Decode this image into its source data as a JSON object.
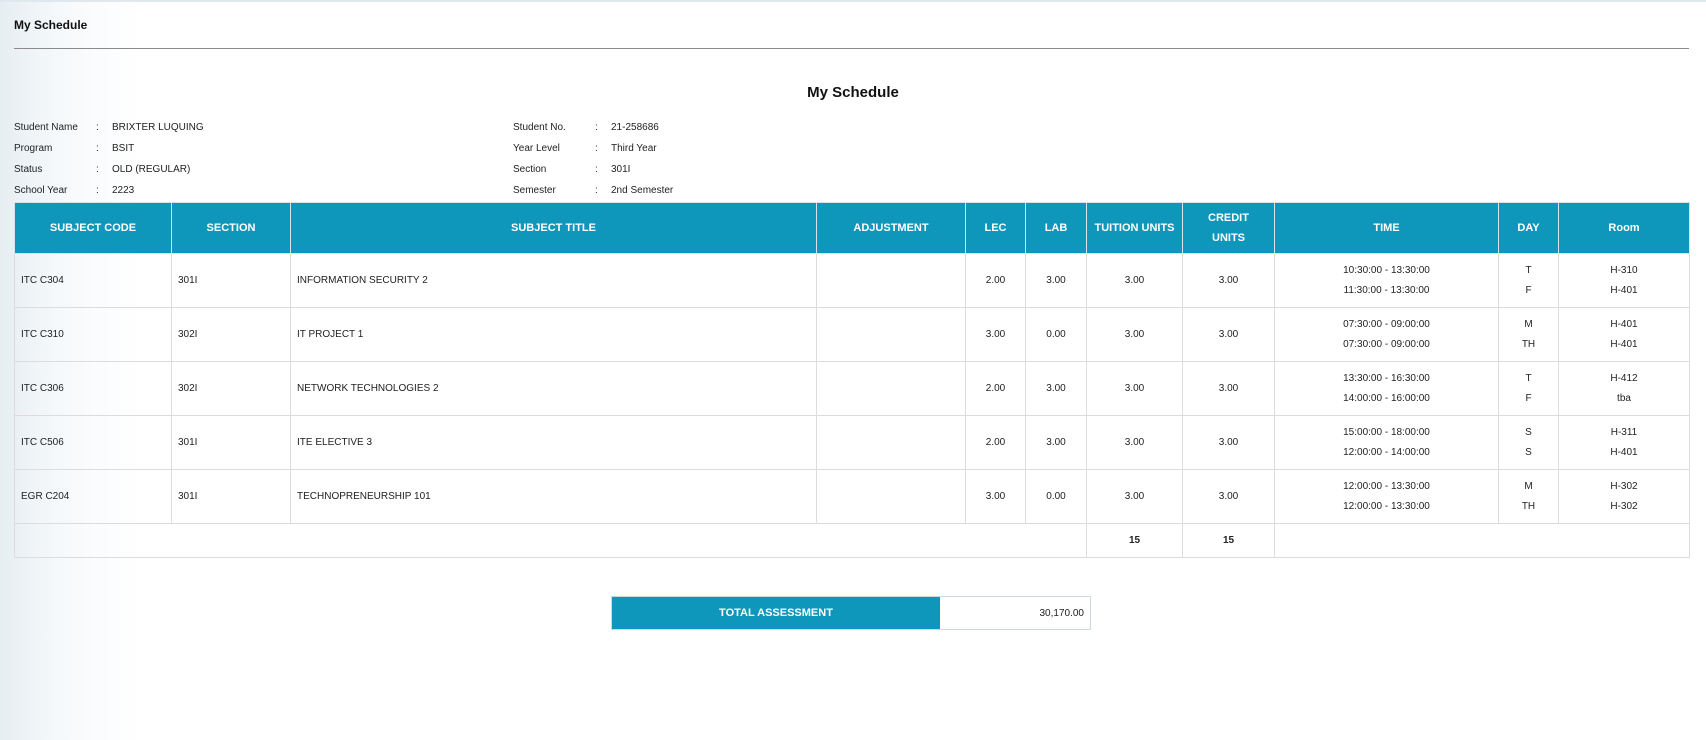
{
  "header": {
    "title": "My Schedule"
  },
  "main": {
    "title": "My Schedule"
  },
  "student_info": {
    "left": [
      {
        "label": "Student Name",
        "value": "BRIXTER LUQUING"
      },
      {
        "label": "Program",
        "value": "BSIT"
      },
      {
        "label": "Status",
        "value": "OLD (REGULAR)"
      },
      {
        "label": "School Year",
        "value": "2223"
      }
    ],
    "right": [
      {
        "label": "Student No.",
        "value": "21-258686"
      },
      {
        "label": "Year Level",
        "value": "Third Year"
      },
      {
        "label": "Section",
        "value": "301I"
      },
      {
        "label": "Semester",
        "value": "2nd Semester"
      }
    ],
    "separator": ":"
  },
  "table": {
    "headers": {
      "subject_code": "SUBJECT CODE",
      "section": "SECTION",
      "subject_title": "SUBJECT TITLE",
      "adjustment": "ADJUSTMENT",
      "lec": "LEC",
      "lab": "LAB",
      "tuition_units": "TUITION UNITS",
      "credit_units_line1": "CREDIT",
      "credit_units_line2": "UNITS",
      "time": "TIME",
      "day": "DAY",
      "room": "Room"
    },
    "rows": [
      {
        "code": "ITC C304",
        "section": "301I",
        "title": "INFORMATION SECURITY 2",
        "adjustment": "",
        "lec": "2.00",
        "lab": "3.00",
        "tuition": "3.00",
        "credit": "3.00",
        "time1": "10:30:00 - 13:30:00",
        "time2": "11:30:00 - 13:30:00",
        "day1": "T",
        "day2": "F",
        "room1": "H-310",
        "room2": "H-401"
      },
      {
        "code": "ITC C310",
        "section": "302I",
        "title": "IT PROJECT 1",
        "adjustment": "",
        "lec": "3.00",
        "lab": "0.00",
        "tuition": "3.00",
        "credit": "3.00",
        "time1": "07:30:00 - 09:00:00",
        "time2": "07:30:00 - 09:00:00",
        "day1": "M",
        "day2": "TH",
        "room1": "H-401",
        "room2": "H-401"
      },
      {
        "code": "ITC C306",
        "section": "302I",
        "title": "NETWORK TECHNOLOGIES 2",
        "adjustment": "",
        "lec": "2.00",
        "lab": "3.00",
        "tuition": "3.00",
        "credit": "3.00",
        "time1": "13:30:00 - 16:30:00",
        "time2": "14:00:00 - 16:00:00",
        "day1": "T",
        "day2": "F",
        "room1": "H-412",
        "room2": "tba"
      },
      {
        "code": "ITC C506",
        "section": "301I",
        "title": "ITE ELECTIVE 3",
        "adjustment": "",
        "lec": "2.00",
        "lab": "3.00",
        "tuition": "3.00",
        "credit": "3.00",
        "time1": "15:00:00 - 18:00:00",
        "time2": "12:00:00 - 14:00:00",
        "day1": "S",
        "day2": "S",
        "room1": "H-311",
        "room2": "H-401"
      },
      {
        "code": "EGR C204",
        "section": "301I",
        "title": "TECHNOPRENEURSHIP 101",
        "adjustment": "",
        "lec": "3.00",
        "lab": "0.00",
        "tuition": "3.00",
        "credit": "3.00",
        "time1": "12:00:00 - 13:30:00",
        "time2": "12:00:00 - 13:30:00",
        "day1": "M",
        "day2": "TH",
        "room1": "H-302",
        "room2": "H-302"
      }
    ],
    "totals": {
      "tuition": "15",
      "credit": "15"
    }
  },
  "assessment": {
    "label": "TOTAL ASSESSMENT",
    "amount": "30,170.00"
  },
  "colors": {
    "accent": "#0e97bb",
    "total_text": "#1a8fb5"
  }
}
